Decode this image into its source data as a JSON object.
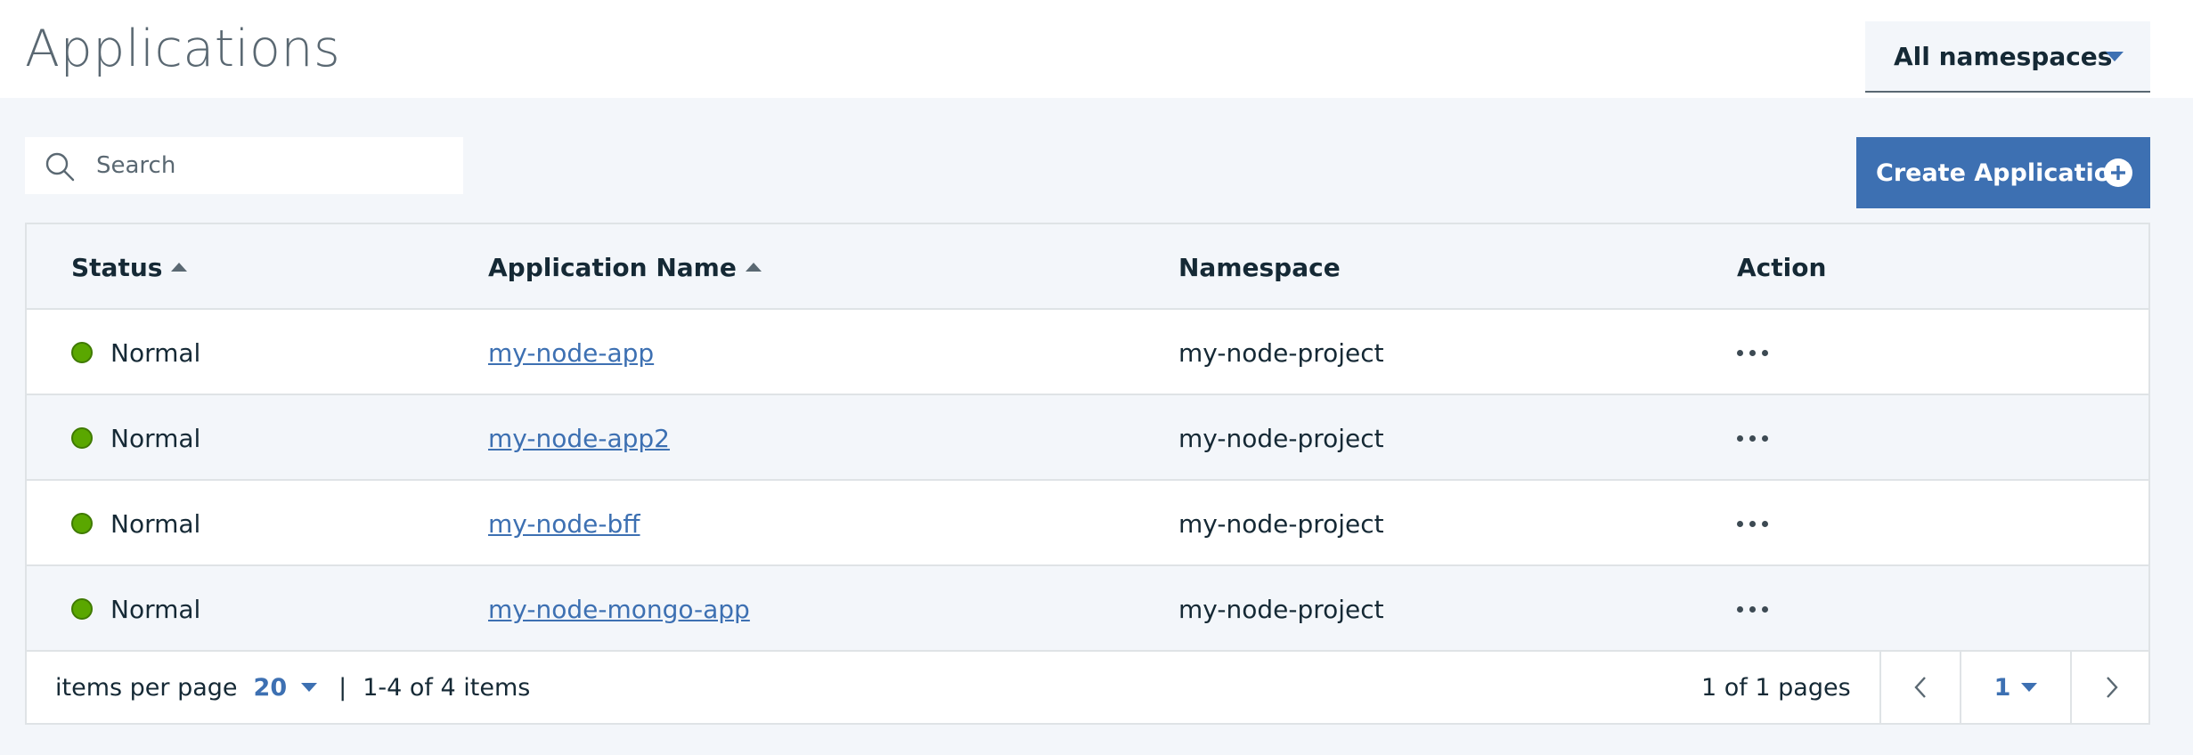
{
  "header": {
    "title": "Applications",
    "namespace_selector": "All namespaces"
  },
  "search": {
    "placeholder": "Search"
  },
  "create_button": {
    "label": "Create Application"
  },
  "table": {
    "columns": {
      "status": "Status",
      "name": "Application Name",
      "namespace": "Namespace",
      "action": "Action"
    },
    "rows": [
      {
        "status": "Normal",
        "name": "my-node-app",
        "namespace": "my-node-project"
      },
      {
        "status": "Normal",
        "name": "my-node-app2",
        "namespace": "my-node-project"
      },
      {
        "status": "Normal",
        "name": "my-node-bff",
        "namespace": "my-node-project"
      },
      {
        "status": "Normal",
        "name": "my-node-mongo-app",
        "namespace": "my-node-project"
      }
    ]
  },
  "pagination": {
    "items_per_page_label": "items per page",
    "items_per_page": "20",
    "separator": "|",
    "range": "1-4 of 4 items",
    "pages_text": "1 of 1 pages",
    "current_page": "1"
  },
  "colors": {
    "accent": "#3d70b2",
    "status_normal": "#5aa700",
    "background": "#f3f6fa"
  },
  "icons": {
    "search": "search-icon",
    "add": "add-circle-icon",
    "prev": "chevron-left-icon",
    "next": "chevron-right-icon",
    "overflow": "overflow-menu-icon"
  }
}
